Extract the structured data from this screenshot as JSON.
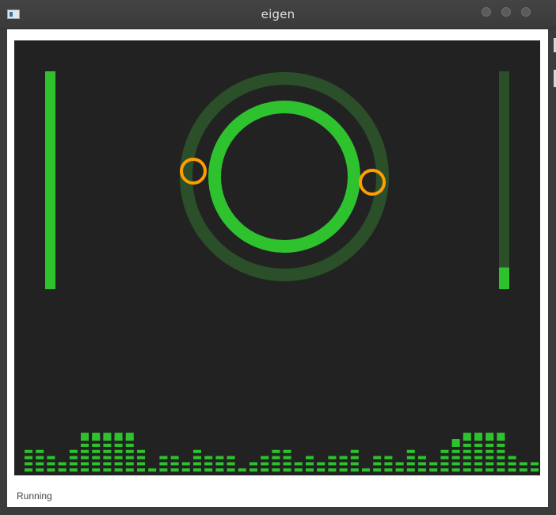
{
  "window": {
    "title": "eigen",
    "icon": "app-window-icon"
  },
  "status_text": "Running",
  "colors": {
    "background": "#232223",
    "accent": "#2fc22f",
    "accent_dim": "#2a4f29",
    "marker": "#ff9e00"
  },
  "meters": {
    "left_level": 1.0,
    "right_level": 0.1
  },
  "equalizer": {
    "levels": [
      4,
      4,
      3,
      2,
      4,
      6,
      6,
      6,
      6,
      6,
      4,
      1,
      3,
      3,
      2,
      4,
      3,
      3,
      3,
      1,
      2,
      3,
      4,
      4,
      2,
      3,
      2,
      3,
      3,
      4,
      1,
      3,
      3,
      2,
      4,
      3,
      2,
      4,
      5,
      6,
      6,
      6,
      6,
      3,
      2,
      2,
      3,
      4,
      4,
      3,
      2,
      1,
      1
    ]
  }
}
